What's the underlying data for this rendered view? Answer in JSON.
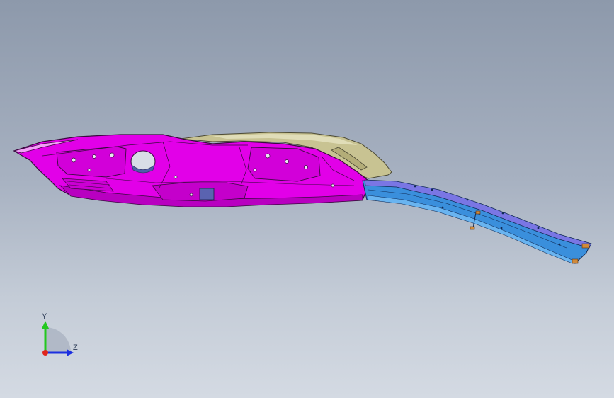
{
  "viewport": {
    "background_top": "#8d99ab",
    "background_bottom": "#d4dae3"
  },
  "model": {
    "parts": [
      {
        "name": "body-shell",
        "color": "#e200e8"
      },
      {
        "name": "top-cover",
        "color": "#c8c392"
      },
      {
        "name": "rail-beam",
        "color": "#3a8fdc"
      },
      {
        "name": "rail-top",
        "color": "#7a76e4"
      },
      {
        "name": "rail-end-clips",
        "color": "#d08a3a"
      }
    ],
    "edge_color": "#3a0a3f"
  },
  "triad": {
    "y_label": "Y",
    "z_label": "Z",
    "y_color": "#22c81e",
    "z_color": "#1c2fe0",
    "x_color": "#e0241c"
  }
}
